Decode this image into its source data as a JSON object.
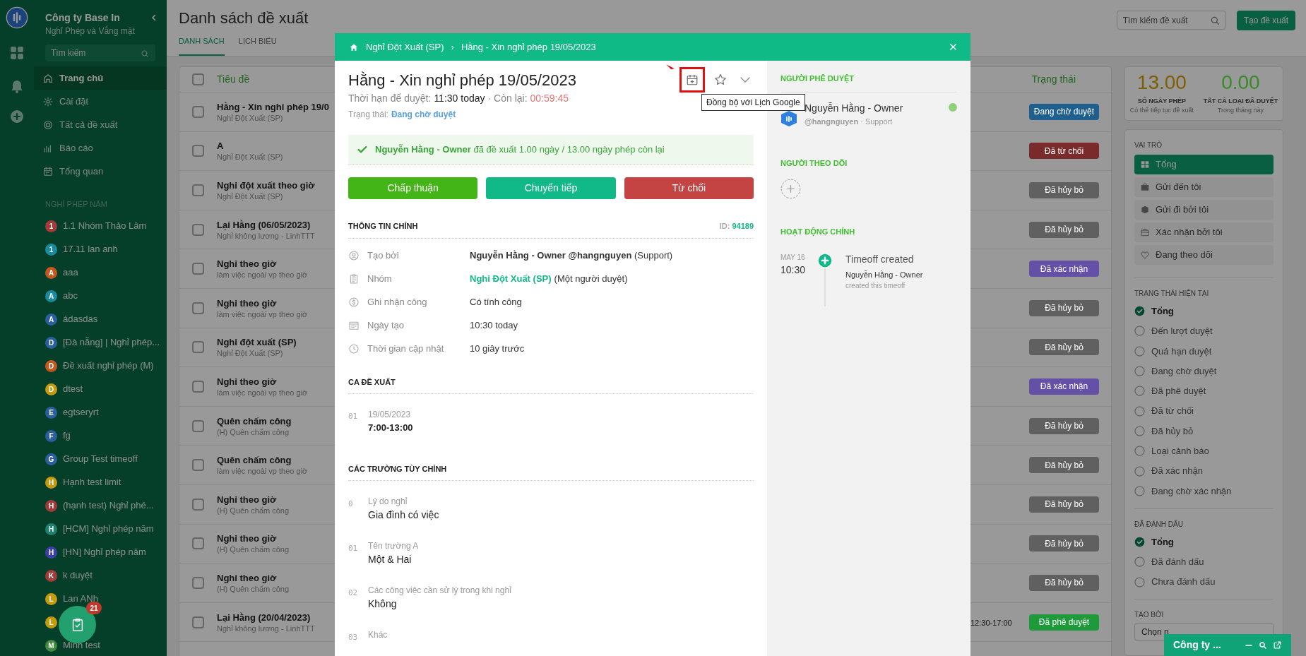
{
  "sidebar": {
    "company": "Công ty Base In",
    "module": "Nghỉ Phép và Vắng mặt",
    "search_placeholder": "Tìm kiếm",
    "nav": [
      {
        "label": "Trang chủ",
        "selected": true
      },
      {
        "label": "Cài đặt",
        "selected": false
      },
      {
        "label": "Tất cả đề xuất",
        "selected": false
      },
      {
        "label": "Báo cáo",
        "selected": false
      },
      {
        "label": "Tổng quan",
        "selected": false
      }
    ],
    "section_label": "NGHỈ PHÉP NĂM",
    "groups": [
      {
        "letter": "1",
        "name": "1.1 Nhóm Thảo Lâm",
        "color": "#a33a3a"
      },
      {
        "letter": "1",
        "name": "17.11 lan anh",
        "color": "#1a8aa0"
      },
      {
        "letter": "A",
        "name": "aaa",
        "color": "#c25a20"
      },
      {
        "letter": "A",
        "name": "abc",
        "color": "#1a8aa0"
      },
      {
        "letter": "A",
        "name": "ádasdas",
        "color": "#2b5f9e"
      },
      {
        "letter": "D",
        "name": "[Đà nẵng] | Nghỉ phép...",
        "color": "#2b5f9e"
      },
      {
        "letter": "D",
        "name": "Đề xuất nghỉ phép (M)",
        "color": "#c25a20"
      },
      {
        "letter": "D",
        "name": "dtest",
        "color": "#c49a10"
      },
      {
        "letter": "E",
        "name": "egtseryrt",
        "color": "#2b5f9e"
      },
      {
        "letter": "F",
        "name": "fg",
        "color": "#2b5f9e"
      },
      {
        "letter": "G",
        "name": "Group Test timeoff",
        "color": "#2b5f9e"
      },
      {
        "letter": "H",
        "name": "Hạnh test limit",
        "color": "#c49a10"
      },
      {
        "letter": "H",
        "name": "(hạnh test) Nghỉ phé...",
        "color": "#a33a3a"
      },
      {
        "letter": "H",
        "name": "[HCM] Nghỉ phép năm",
        "color": "#20806f"
      },
      {
        "letter": "H",
        "name": "[HN] Nghỉ phép năm",
        "color": "#3f3fa8"
      },
      {
        "letter": "K",
        "name": "k duyệt",
        "color": "#a33a3a"
      },
      {
        "letter": "L",
        "name": "Lan ANh",
        "color": "#c49a10"
      },
      {
        "letter": "L",
        "color": "#c49a10"
      },
      {
        "letter": "M",
        "name": "Minh test",
        "color": "#3f8a3f"
      }
    ],
    "fab_badge": "21"
  },
  "header": {
    "title": "Danh sách đề xuất",
    "tabs": [
      {
        "label": "DANH SÁCH",
        "selected": true
      },
      {
        "label": "LỊCH BIỂU",
        "selected": false
      }
    ],
    "search_placeholder": "Tìm kiếm đề xuất",
    "create_button": "Tạo đề xuất"
  },
  "table": {
    "columns": [
      "Tiêu đề",
      "Trạng thái"
    ],
    "all_checked": false,
    "rows": [
      {
        "checked": false,
        "title": "Hằng - Xin nghỉ phép 19/0",
        "subtitle": "Nghỉ Đột Xuất (SP)",
        "status": "Đang chờ duyệt",
        "kind": "pending"
      },
      {
        "checked": false,
        "title": "A",
        "subtitle": "Nghỉ Đột Xuất (SP)",
        "status": "Đã từ chối",
        "kind": "rejected"
      },
      {
        "checked": false,
        "title": "Nghỉ đột xuất theo giờ",
        "subtitle": "Nghỉ Đột Xuất (SP)",
        "status": "Đã hủy bỏ",
        "kind": "canceled"
      },
      {
        "checked": false,
        "title": "Lại Hằng (06/05/2023)",
        "subtitle": "Nghỉ không lương - LinhTTT",
        "status": "Đã hủy bỏ",
        "kind": "canceled"
      },
      {
        "checked": false,
        "title": "Nghỉ theo giờ",
        "subtitle": "làm việc ngoài vp theo giờ",
        "status": "Đã xác nhận",
        "kind": "confirmed"
      },
      {
        "checked": false,
        "title": "Nghỉ theo giờ",
        "subtitle": "làm việc ngoài vp theo giờ",
        "status": "Đã hủy bỏ",
        "kind": "canceled"
      },
      {
        "checked": false,
        "title": "Nghỉ đột xuất (SP)",
        "subtitle": "Nghỉ Đột Xuất (SP)",
        "status": "Đã hủy bỏ",
        "kind": "canceled"
      },
      {
        "checked": false,
        "title": "Nghỉ theo giờ",
        "subtitle": "làm việc ngoài vp theo giờ",
        "status": "Đã xác nhận",
        "kind": "confirmed"
      },
      {
        "checked": false,
        "title": "Quên chấm công",
        "subtitle": "(H) Quên chấm công",
        "status": "Đã hủy bỏ",
        "kind": "canceled"
      },
      {
        "checked": false,
        "title": "Quên chấm công",
        "subtitle": "làm việc ngoài vp theo giờ",
        "status": "Đã hủy bỏ",
        "kind": "canceled"
      },
      {
        "checked": false,
        "title": "Nghỉ theo giờ",
        "subtitle": "(H) Quên chấm công",
        "status": "Đã hủy bỏ",
        "kind": "canceled"
      },
      {
        "checked": false,
        "title": "Nghỉ theo giờ",
        "subtitle": "(H) Quên chấm công",
        "status": "Đã hủy bỏ",
        "kind": "canceled"
      },
      {
        "checked": false,
        "title": "Nghỉ theo giờ",
        "subtitle": "(H) Quên chấm công",
        "status": "Đã hủy bỏ",
        "kind": "canceled"
      },
      {
        "checked": false,
        "title": "Lại Hằng (20/04/2023)",
        "subtitle": "Nghỉ không lương - LinhTTT",
        "time": "12:30-17:00",
        "status": "Đã phê duyệt",
        "kind": "approved"
      }
    ]
  },
  "summary": [
    {
      "value": "13.00",
      "label": "SỐ NGÀY PHÉP",
      "note": "Có thể tiếp tục đề xuất",
      "color": "#7d5e00"
    },
    {
      "value": "0.00",
      "label": "TẤT CẢ LOẠI ĐÃ DUYỆT",
      "note": "Trong tháng này",
      "color": "#3a8a2a"
    }
  ],
  "filters": {
    "role_title": "VAI TRÒ",
    "roles": [
      {
        "label": "Tổng",
        "selected": true
      },
      {
        "label": "Gửi đến tôi",
        "selected": false
      },
      {
        "label": "Gửi đi bởi tôi",
        "selected": false
      },
      {
        "label": "Xác nhận bởi tôi",
        "selected": false
      },
      {
        "label": "Đang theo dõi",
        "selected": false
      }
    ],
    "state_title": "TRẠNG THÁI HIỆN TẠI",
    "states": [
      {
        "label": "Tổng",
        "checked": true
      },
      {
        "label": "Đến lượt duyệt",
        "checked": false
      },
      {
        "label": "Quá hạn duyệt",
        "checked": false
      },
      {
        "label": "Đang chờ duyệt",
        "checked": false
      },
      {
        "label": "Đã phê duyệt",
        "checked": false
      },
      {
        "label": "Đã từ chối",
        "checked": false
      },
      {
        "label": "Đã hủy bỏ",
        "checked": false
      },
      {
        "label": "Loại cảnh báo",
        "checked": false
      },
      {
        "label": "Đã xác nhận",
        "checked": false
      },
      {
        "label": "Đang chờ xác nhận",
        "checked": false
      }
    ],
    "mark_title": "ĐÃ ĐÁNH DẤU",
    "marks": [
      {
        "label": "Tổng",
        "checked": true
      },
      {
        "label": "Đã đánh dấu",
        "checked": false
      },
      {
        "label": "Chưa đánh dấu",
        "checked": false
      }
    ],
    "creator_title": "TẠO BỞI",
    "creator_select": "Chọn n"
  },
  "modal": {
    "breadcrumb": [
      "Nghỉ Đột Xuất (SP)",
      "Hằng - Xin nghỉ phép 19/05/2023"
    ],
    "breadcrumb_separator": "›",
    "title": "Hằng - Xin nghỉ phép 19/05/2023",
    "deadline_label": "Thời hạn để duyệt:",
    "deadline": "11:30 today",
    "remaining_label": "· Còn lại:",
    "remaining": "00:59:45",
    "status_label": "Trạng thái:",
    "status": "Đang chờ duyệt",
    "tooltip": "Đồng bộ với Lịch Google",
    "notice": "**Nguyễn Hằng - Owner** đã đề xuất 1.00 ngày / 13.00 ngày phép còn lại",
    "actions": [
      {
        "label": "Chấp thuận",
        "kind": "approve"
      },
      {
        "label": "Chuyển tiếp",
        "kind": "forward"
      },
      {
        "label": "Từ chối",
        "kind": "reject"
      }
    ],
    "main_info": {
      "heading": "THÔNG TIN CHÍNH",
      "id_label": "ID:",
      "id": "94189",
      "rows": [
        {
          "label": "Tạo bởi",
          "value": "**Nguyễn Hằng - Owner @hangnguyen** (Support)"
        },
        {
          "label": "Nhóm",
          "link": "Nghỉ Đột Xuất (SP)",
          "value": "(Một người duyệt)"
        },
        {
          "label": "Ghi nhận công",
          "value": "Có tính công"
        },
        {
          "label": "Ngày tạo",
          "value": "10:30 today"
        },
        {
          "label": "Thời gian cập nhật",
          "value": "10 giây trước"
        }
      ]
    },
    "shifts": {
      "heading": "CA ĐỀ XUẤT",
      "items": [
        {
          "index": "01",
          "date": "19/05/2023",
          "time": "7:00-13:00"
        }
      ]
    },
    "custom_fields": {
      "heading": "CÁC TRƯỜNG TÙY CHỈNH",
      "items": [
        {
          "index": "0",
          "label": "Lý do nghỉ",
          "value": "Gia đình có việc"
        },
        {
          "index": "01",
          "label": "Tên trường A",
          "value": "Một & Hai"
        },
        {
          "index": "02",
          "label": "Các công việc cần sử lý trong khi nghỉ",
          "value": "Không"
        },
        {
          "index": "03",
          "label": "Khác"
        }
      ]
    },
    "approvers": {
      "heading": "NGƯỜI PHÊ DUYỆT",
      "items": [
        {
          "name": "Nguyễn Hằng - Owner",
          "meta": "**@hangnguyen** · Support",
          "online": true
        }
      ]
    },
    "followers": {
      "heading": "NGƯỜI THEO DÕI"
    },
    "activity": {
      "heading": "HOẠT ĐỘNG CHÍNH",
      "items": [
        {
          "date": "MAY 16",
          "time": "10:30",
          "title": "Timeoff created",
          "actor": "Nguyễn Hằng - Owner",
          "note": "created this timeoff"
        }
      ]
    }
  },
  "chat_widget": {
    "title": "Công ty ..."
  }
}
